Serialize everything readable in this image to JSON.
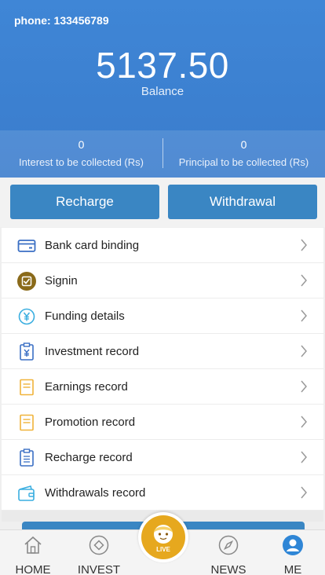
{
  "header": {
    "phone_label": "phone:",
    "phone_number": "133456789",
    "balance_value": "5137.50",
    "balance_label": "Balance",
    "interest_value": "0",
    "interest_label": "Interest to be collected (Rs)",
    "principal_value": "0",
    "principal_label": "Principal to be collected (Rs)"
  },
  "actions": {
    "recharge_label": "Recharge",
    "withdrawal_label": "Withdrawal"
  },
  "menu": {
    "items": [
      {
        "label": "Bank card binding",
        "icon": "bank-card-icon"
      },
      {
        "label": "Signin",
        "icon": "signin-check-icon"
      },
      {
        "label": "Funding details",
        "icon": "yen-circle-icon"
      },
      {
        "label": "Investment record",
        "icon": "clipboard-yen-icon"
      },
      {
        "label": "Earnings record",
        "icon": "document-icon"
      },
      {
        "label": "Promotion record",
        "icon": "document-icon"
      },
      {
        "label": "Recharge record",
        "icon": "clipboard-list-icon"
      },
      {
        "label": "Withdrawals record",
        "icon": "wallet-icon"
      }
    ]
  },
  "tabbar": {
    "home_label": "HOME",
    "invest_label": "INVEST",
    "live_label": "LIVE",
    "news_label": "NEWS",
    "me_label": "ME"
  },
  "colors": {
    "header_blue": "#3f86d6",
    "button_blue": "#3a86c3",
    "live_gold": "#e6a81e",
    "me_active_blue": "#2f86d6"
  }
}
